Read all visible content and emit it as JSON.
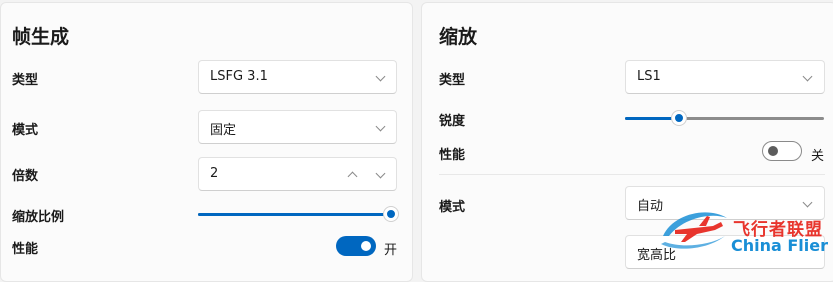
{
  "frame_gen": {
    "title": "帧生成",
    "type_label": "类型",
    "type_value": "LSFG 3.1",
    "mode_label": "模式",
    "mode_value": "固定",
    "multiplier_label": "倍数",
    "multiplier_value": "2",
    "scale_label": "缩放比例",
    "scale_level": 1.0,
    "performance_label": "性能",
    "performance_state": "开"
  },
  "scaling": {
    "title": "缩放",
    "type_label": "类型",
    "type_value": "LS1",
    "sharpness_label": "锐度",
    "sharpness_level": 0.27,
    "performance_label": "性能",
    "performance_state": "关",
    "mode_label": "模式",
    "mode_value": "自动",
    "aspect_value": "宽高比"
  },
  "watermark": {
    "chinese": "飞行者联盟",
    "english": "China Flier"
  },
  "colors": {
    "accent": "#0067c0",
    "watermark_red": "#e8352d",
    "watermark_blue": "#1a8fd6"
  }
}
